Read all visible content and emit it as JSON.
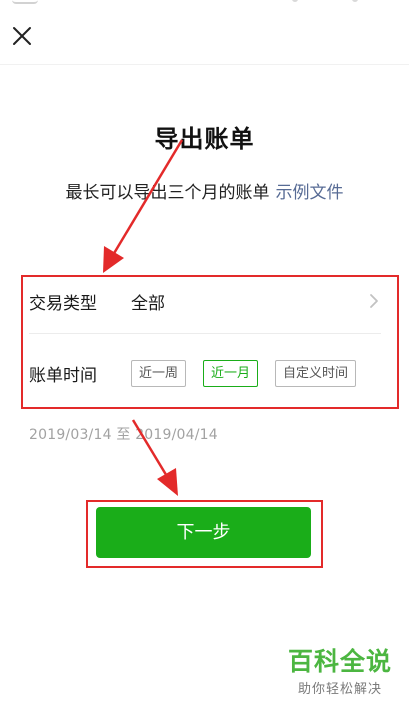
{
  "header": {
    "close_icon": "close-icon"
  },
  "main": {
    "title": "导出账单",
    "subtitle": "最长可以导出三个月的账单",
    "sample_link": "示例文件"
  },
  "form": {
    "type_label": "交易类型",
    "type_value": "全部",
    "time_label": "账单时间",
    "time_options": [
      "近一周",
      "近一月",
      "自定义时间"
    ],
    "time_selected": "近一月",
    "date_range": "2019/03/14 至 2019/04/14"
  },
  "actions": {
    "next_label": "下一步"
  },
  "watermark": {
    "main": "百科全说",
    "sub": "助你轻松解决"
  },
  "colors": {
    "accent": "#1aad19",
    "link": "#576b95",
    "annotation": "#e32a2a",
    "watermark": "#4cb641"
  }
}
